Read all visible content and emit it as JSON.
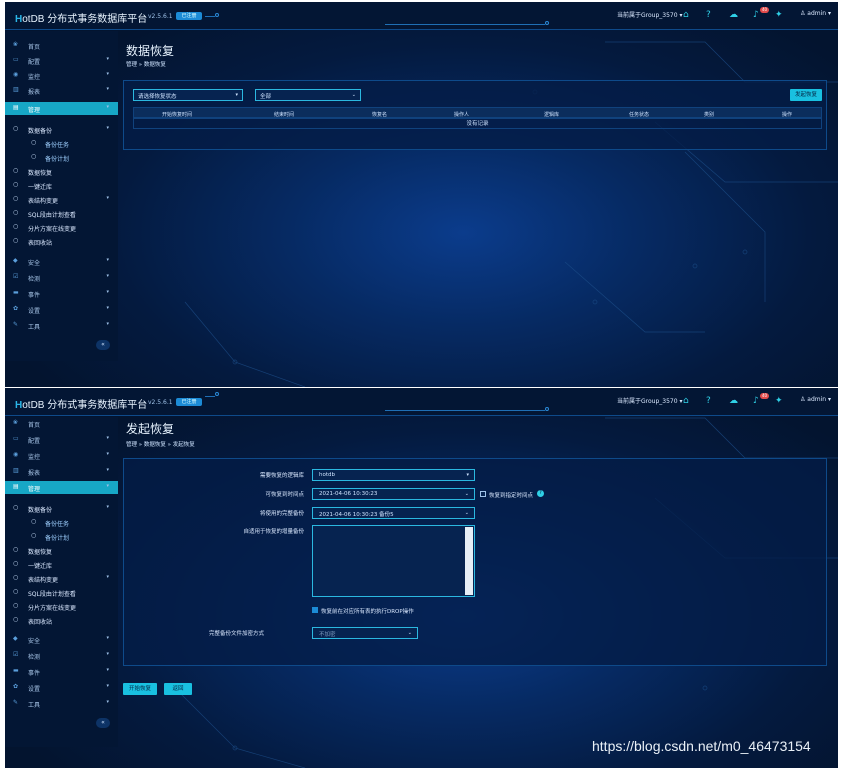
{
  "app": {
    "logo_prefix": "H",
    "logo_rest": "otDB",
    "title": "分布式事务数据库平台",
    "version": "v2.5.6.1",
    "version_badge": "已注册",
    "group": "当前属于Group_3570",
    "notification_count": "40",
    "user": "admin"
  },
  "sidebar": {
    "items": [
      {
        "icon": "❀",
        "label": "首页"
      },
      {
        "icon": "▭",
        "label": "配置",
        "arrow": "▾"
      },
      {
        "icon": "◉",
        "label": "监控",
        "arrow": "▾"
      },
      {
        "icon": "▥",
        "label": "报表",
        "arrow": "▾"
      },
      {
        "icon": "▤",
        "label": "管理",
        "arrow": "▾"
      }
    ],
    "manage_children": [
      {
        "label": "数据备份",
        "arrow": "▾"
      },
      {
        "label": "备份任务"
      },
      {
        "label": "备份计划"
      },
      {
        "label": "数据恢复"
      },
      {
        "label": "一键迁库"
      },
      {
        "label": "表结构变更",
        "arrow": "▾"
      },
      {
        "label": "SQL段由计划查看"
      },
      {
        "label": "分片方案在线变更"
      },
      {
        "label": "表回收站"
      }
    ],
    "bottom": [
      {
        "icon": "◆",
        "label": "安全",
        "arrow": "▾"
      },
      {
        "icon": "☑",
        "label": "检测",
        "arrow": "▾"
      },
      {
        "icon": "▬",
        "label": "事件",
        "arrow": "▾"
      },
      {
        "icon": "✿",
        "label": "设置",
        "arrow": "▾"
      },
      {
        "icon": "✎",
        "label": "工具",
        "arrow": "▾"
      }
    ],
    "collapse": "«"
  },
  "page1": {
    "title": "数据恢复",
    "breadcrumb": "管理 » 数据恢复",
    "filter_placeholder": "请选择恢复状态",
    "filter_value": "全部",
    "start_button": "发起恢复",
    "columns": [
      "开始恢复时间",
      "结束时间",
      "恢复名",
      "操作人",
      "逻辑库",
      "任务状态",
      "类别",
      "操作"
    ],
    "empty_text": "没有记录"
  },
  "page2": {
    "title": "发起恢复",
    "breadcrumb": "管理 » 数据恢复 » 发起恢复",
    "fields": {
      "logic_db_label": "需要恢复的逻辑库",
      "logic_db_value": "hotdb",
      "restore_time_label": "可恢复到时间点",
      "restore_time_value": "2021-04-06 10:30:23",
      "restore_time_check": "恢复到指定时间点",
      "backup_label": "将使用的完整备份",
      "backup_value": "2021-04-06 10:30:23 备份5",
      "incr_label": "自适用于恢复的增量备份",
      "ddl_check": "恢复前在对应所有表的执行DROP操作",
      "encrypt_label": "完整备份文件加密方式",
      "encrypt_value": "不加密"
    },
    "start_button": "开始恢复",
    "back_button": "返回"
  },
  "watermark": "https://blog.csdn.net/m0_46473154"
}
